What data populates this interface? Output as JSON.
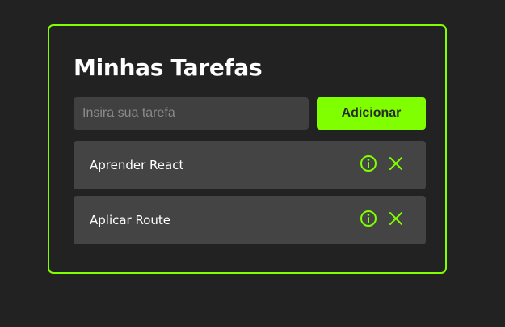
{
  "app": {
    "title": "Minhas Tarefas"
  },
  "form": {
    "input_value": "",
    "input_placeholder": "Insira sua tarefa",
    "add_label": "Adicionar"
  },
  "tasks": [
    {
      "label": "Aprender React",
      "info_icon": "info-circle-icon",
      "remove_icon": "close-icon"
    },
    {
      "label": "Aplicar Route",
      "info_icon": "info-circle-icon",
      "remove_icon": "close-icon"
    }
  ],
  "colors": {
    "accent": "#7fff00",
    "background": "#222222",
    "input_bg": "#404040",
    "task_bg": "#444444",
    "text": "#ffffff"
  }
}
